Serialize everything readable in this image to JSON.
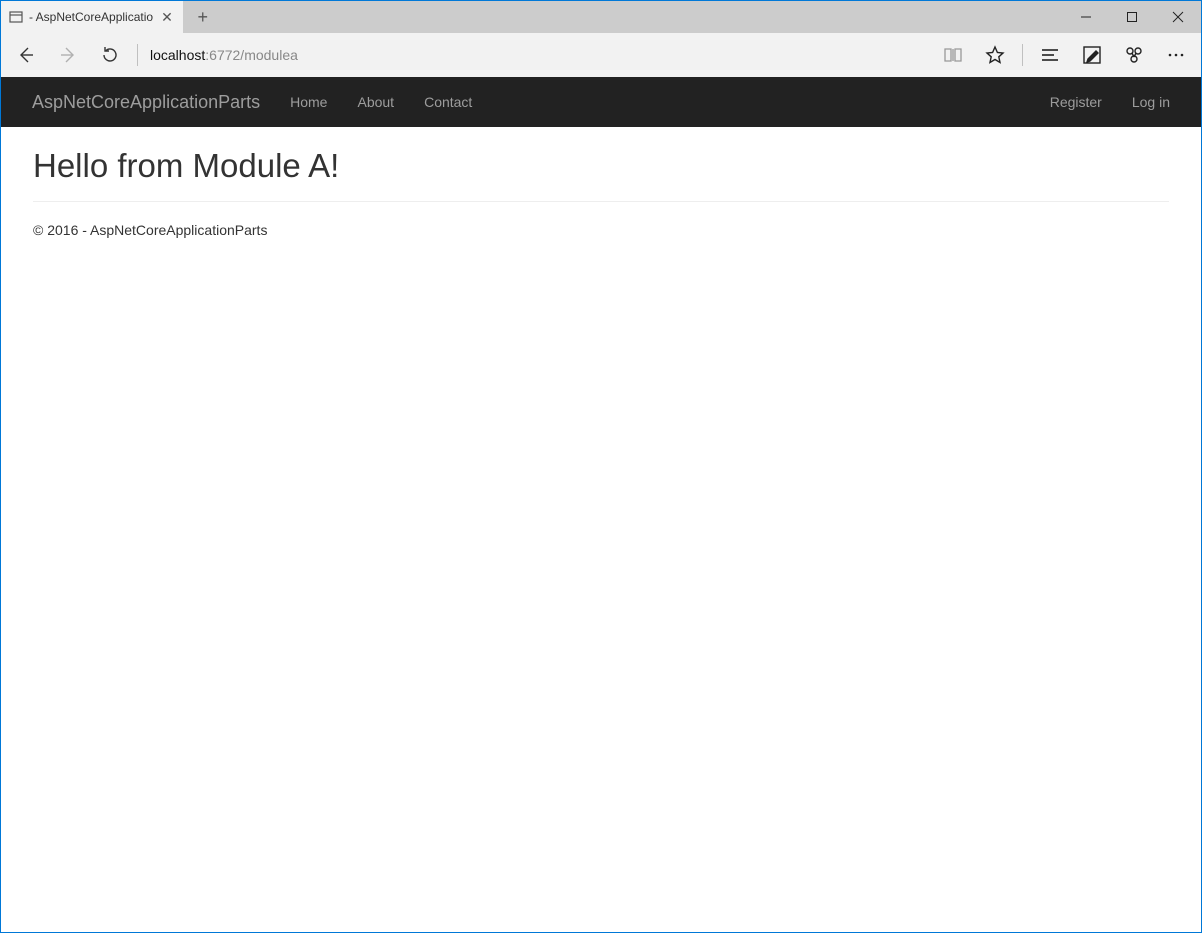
{
  "browser": {
    "tab_title": " - AspNetCoreApplicatio",
    "url_host": "localhost",
    "url_path": ":6772/modulea"
  },
  "navbar": {
    "brand": "AspNetCoreApplicationParts",
    "links": {
      "home": "Home",
      "about": "About",
      "contact": "Contact"
    },
    "right_links": {
      "register": "Register",
      "login": "Log in"
    }
  },
  "page": {
    "heading": "Hello from Module A!",
    "footer": "© 2016 - AspNetCoreApplicationParts"
  }
}
